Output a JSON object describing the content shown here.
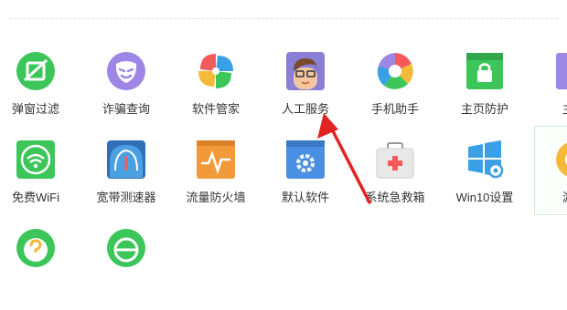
{
  "tools": [
    {
      "label": "弹窗过滤",
      "icon": "popup-filter-icon",
      "color": "#3cc65a"
    },
    {
      "label": "诈骗查询",
      "icon": "fraud-query-icon",
      "color": "#9d86e6"
    },
    {
      "label": "软件管家",
      "icon": "software-manager-icon",
      "color": "#f19a3a"
    },
    {
      "label": "人工服务",
      "icon": "human-service-icon",
      "color": "#8a7fd6"
    },
    {
      "label": "手机助手",
      "icon": "phone-assistant-icon",
      "color": "#f45a5a"
    },
    {
      "label": "主页防护",
      "icon": "homepage-protect-icon",
      "color": "#3cc65a"
    },
    {
      "label": "主页",
      "icon": "homepage-icon",
      "color": "#9d86e6"
    },
    {
      "label": "免费WiFi",
      "icon": "wifi-icon",
      "color": "#3cc65a"
    },
    {
      "label": "宽带测速器",
      "icon": "speed-test-icon",
      "color": "#2f6fb8"
    },
    {
      "label": "流量防火墙",
      "icon": "firewall-icon",
      "color": "#f19a3a"
    },
    {
      "label": "默认软件",
      "icon": "default-software-icon",
      "color": "#4a90e2"
    },
    {
      "label": "系统急救箱",
      "icon": "first-aid-icon",
      "color": "#e8e8e8"
    },
    {
      "label": "Win10设置",
      "icon": "windows-settings-icon",
      "color": "#3aa0e6"
    },
    {
      "label": "游戏",
      "icon": "game-icon",
      "color": "#f4b93a"
    },
    {
      "label": "",
      "icon": "help-icon",
      "color": "#3cc65a"
    },
    {
      "label": "",
      "icon": "edge-icon",
      "color": "#3cc65a"
    }
  ]
}
